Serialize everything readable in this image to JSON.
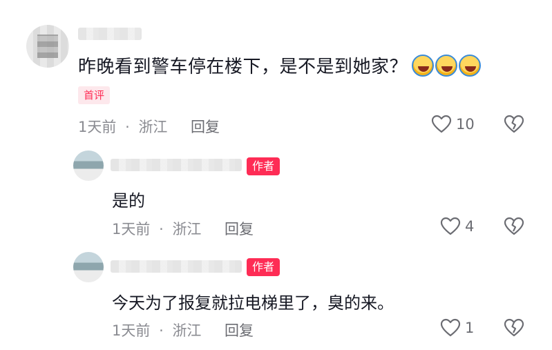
{
  "comment": {
    "text": "昨晚看到警车停在楼下，是不是到她家？",
    "emoji_name": "laugh-cry-emoji",
    "badge": "首评",
    "time": "1天前",
    "sep": "·",
    "location": "浙江",
    "reply_label": "回复",
    "likes": "10"
  },
  "replies": [
    {
      "badge": "作者",
      "text": "是的",
      "time": "1天前",
      "sep": "·",
      "location": "浙江",
      "reply_label": "回复",
      "likes": "4"
    },
    {
      "badge": "作者",
      "text": "今天为了报复就拉电梯里了，臭的来。",
      "time": "1天前",
      "sep": "·",
      "location": "浙江",
      "reply_label": "回复",
      "likes": "1"
    }
  ],
  "icons": {
    "like": "heart-outline-icon",
    "dislike": "broken-heart-icon"
  },
  "colors": {
    "accent": "#fe2c55",
    "meta": "#8a8b91",
    "text": "#161823"
  }
}
